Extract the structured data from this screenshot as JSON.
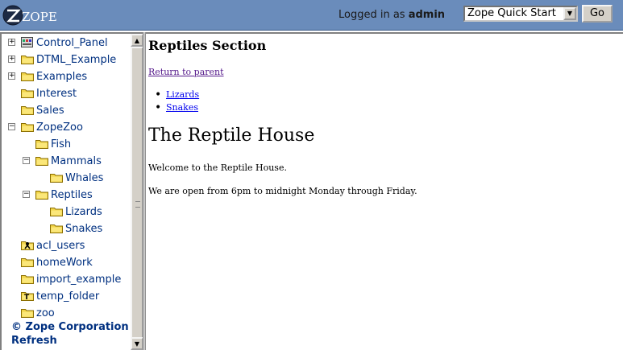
{
  "header": {
    "logo_text": "ZOPE",
    "logged_in_prefix": "Logged in as",
    "username": "admin",
    "quick_start_selected": "Zope Quick Start",
    "go_label": "Go"
  },
  "tree": {
    "items": [
      {
        "label": "Control_Panel",
        "icon": "control-panel-icon",
        "expander": "+"
      },
      {
        "label": "DTML_Example",
        "icon": "folder-icon",
        "expander": "+"
      },
      {
        "label": "Examples",
        "icon": "folder-icon",
        "expander": "+"
      },
      {
        "label": "Interest",
        "icon": "folder-icon",
        "expander": ""
      },
      {
        "label": "Sales",
        "icon": "folder-icon",
        "expander": ""
      },
      {
        "label": "ZopeZoo",
        "icon": "folder-icon",
        "expander": "−"
      },
      {
        "label": "Fish",
        "icon": "folder-icon",
        "expander": ""
      },
      {
        "label": "Mammals",
        "icon": "folder-icon",
        "expander": "−"
      },
      {
        "label": "Whales",
        "icon": "folder-icon",
        "expander": ""
      },
      {
        "label": "Reptiles",
        "icon": "folder-icon",
        "expander": "−"
      },
      {
        "label": "Lizards",
        "icon": "folder-icon",
        "expander": ""
      },
      {
        "label": "Snakes",
        "icon": "folder-icon",
        "expander": ""
      },
      {
        "label": "acl_users",
        "icon": "user-folder-icon",
        "expander": ""
      },
      {
        "label": "homeWork",
        "icon": "folder-icon",
        "expander": ""
      },
      {
        "label": "import_example",
        "icon": "folder-icon",
        "expander": ""
      },
      {
        "label": "temp_folder",
        "icon": "temp-folder-icon",
        "expander": ""
      },
      {
        "label": "zoo",
        "icon": "folder-icon",
        "expander": ""
      }
    ],
    "corp_label": "© Zope Corporation",
    "refresh_label": "Refresh"
  },
  "content": {
    "section_title": "Reptiles Section",
    "return_link": "Return to parent",
    "sub_links": [
      "Lizards",
      "Snakes"
    ],
    "house_title": "The Reptile House",
    "welcome_text": "Welcome to the Reptile House.",
    "hours_text": "We are open from 6pm to midnight Monday through Friday."
  },
  "colors": {
    "header_bg": "#6a8cbb",
    "tree_text": "#003080",
    "visited_link": "#551a8b",
    "link": "#0000ee"
  }
}
